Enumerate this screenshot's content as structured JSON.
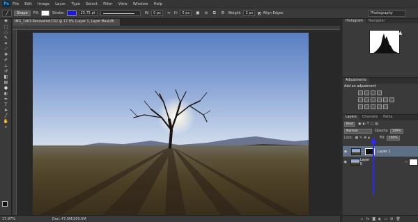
{
  "menu": {
    "logo": "Ps",
    "items": [
      "File",
      "Edit",
      "Image",
      "Layer",
      "Type",
      "Select",
      "Filter",
      "View",
      "Window",
      "Help"
    ]
  },
  "options": {
    "tool_mode": "Shape",
    "fill_label": "Fill:",
    "stroke_label": "Stroke:",
    "stroke_width": "25.75 pt",
    "w_label": "W:",
    "w_value": "0 px",
    "h_label": "H:",
    "h_value": "0 px",
    "weight_label": "Weight:",
    "weight_value": "3 px",
    "align_edges_label": "Align Edges",
    "workspace": "Photography",
    "fill_color": "#ffffff",
    "stroke_color": "#1a1ad6"
  },
  "document": {
    "tab_title": "IMG_1463-Recovered.CR2 @ 17.9% (Layer 1, Layer Mask/8)"
  },
  "status": {
    "zoom": "17.97%",
    "doc_size": "Doc: 47.0M/209.5M"
  },
  "panels": {
    "histogram_tab": "Histogram",
    "navigator_tab": "Navigator",
    "adjustments_tab": "Adjustments",
    "adjustments_title": "Add an adjustment",
    "layers_tab": "Layers",
    "channels_tab": "Channels",
    "paths_tab": "Paths",
    "kind_label": "Kind",
    "blend_mode": "Normal",
    "opacity_label": "Opacity:",
    "opacity_value": "100%",
    "lock_label": "Lock:",
    "fill_label": "Fill:",
    "fill_value": "100%",
    "layers": [
      {
        "name": "Layer 1"
      },
      {
        "name": "Layer 0"
      }
    ]
  },
  "colors": {
    "accent_arrow": "#2b2bff",
    "selected_layer": "#5f6f86"
  }
}
